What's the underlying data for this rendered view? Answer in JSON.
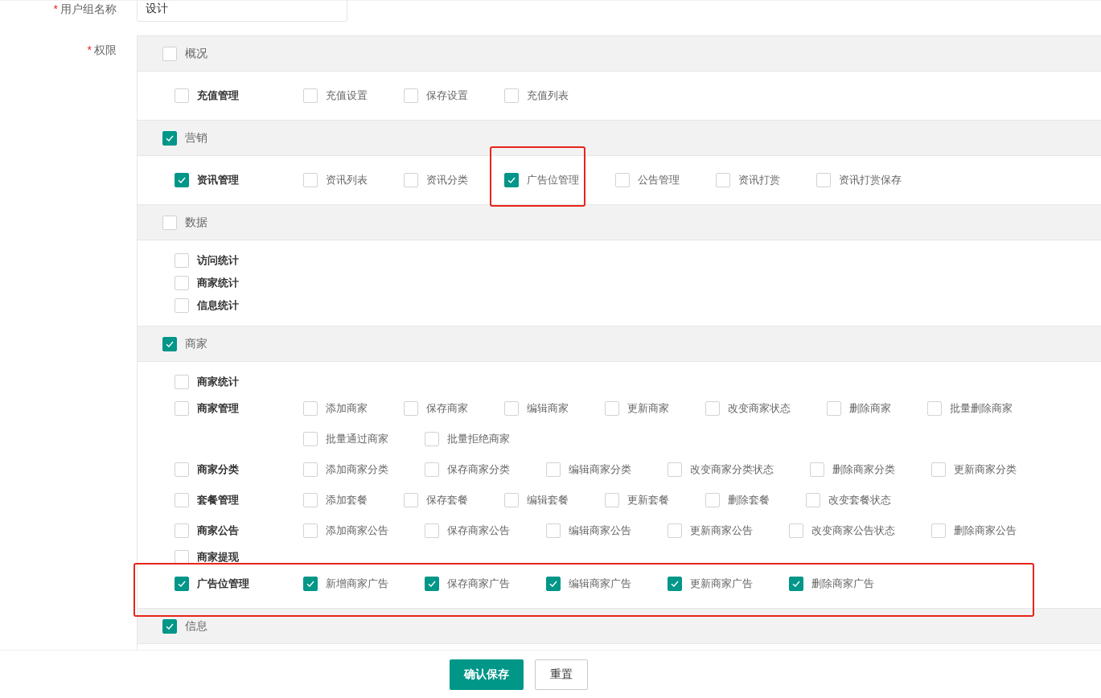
{
  "form": {
    "name_field": {
      "mark": "*",
      "label": "用户组名称",
      "value": "设计"
    },
    "permissions": {
      "mark": "*",
      "label": "权限"
    }
  },
  "sections": [
    {
      "label": "概况",
      "checked": false,
      "groups": [
        {
          "label": "充值管理",
          "checked": false,
          "highlighted": false,
          "children": [
            {
              "label": "充值设置",
              "checked": false,
              "highlighted": false
            },
            {
              "label": "保存设置",
              "checked": false,
              "highlighted": false
            },
            {
              "label": "充值列表",
              "checked": false,
              "highlighted": false
            }
          ]
        }
      ]
    },
    {
      "label": "营销",
      "checked": true,
      "groups": [
        {
          "label": "资讯管理",
          "checked": true,
          "highlighted": false,
          "children": [
            {
              "label": "资讯列表",
              "checked": false,
              "highlighted": false
            },
            {
              "label": "资讯分类",
              "checked": false,
              "highlighted": false
            },
            {
              "label": "广告位管理",
              "checked": true,
              "highlighted": true
            },
            {
              "label": "公告管理",
              "checked": false,
              "highlighted": false
            },
            {
              "label": "资讯打赏",
              "checked": false,
              "highlighted": false
            },
            {
              "label": "资讯打赏保存",
              "checked": false,
              "highlighted": false
            }
          ]
        }
      ]
    },
    {
      "label": "数据",
      "checked": false,
      "groups": [
        {
          "label": "访问统计",
          "checked": false,
          "highlighted": false
        },
        {
          "label": "商家统计",
          "checked": false,
          "highlighted": false
        },
        {
          "label": "信息统计",
          "checked": false,
          "highlighted": false
        }
      ]
    },
    {
      "label": "商家",
      "checked": true,
      "groups": [
        {
          "label": "商家统计",
          "checked": false,
          "highlighted": false
        },
        {
          "label": "商家管理",
          "checked": false,
          "highlighted": false,
          "children": [
            {
              "label": "添加商家",
              "checked": false,
              "highlighted": false
            },
            {
              "label": "保存商家",
              "checked": false,
              "highlighted": false
            },
            {
              "label": "编辑商家",
              "checked": false,
              "highlighted": false
            },
            {
              "label": "更新商家",
              "checked": false,
              "highlighted": false
            },
            {
              "label": "改变商家状态",
              "checked": false,
              "highlighted": false
            },
            {
              "label": "删除商家",
              "checked": false,
              "highlighted": false
            },
            {
              "label": "批量删除商家",
              "checked": false,
              "highlighted": false
            },
            {
              "label": "批量通过商家",
              "checked": false,
              "highlighted": false
            },
            {
              "label": "批量拒绝商家",
              "checked": false,
              "highlighted": false
            }
          ]
        },
        {
          "label": "商家分类",
          "checked": false,
          "highlighted": false,
          "children": [
            {
              "label": "添加商家分类",
              "checked": false,
              "highlighted": false
            },
            {
              "label": "保存商家分类",
              "checked": false,
              "highlighted": false
            },
            {
              "label": "编辑商家分类",
              "checked": false,
              "highlighted": false
            },
            {
              "label": "改变商家分类状态",
              "checked": false,
              "highlighted": false
            },
            {
              "label": "删除商家分类",
              "checked": false,
              "highlighted": false
            },
            {
              "label": "更新商家分类",
              "checked": false,
              "highlighted": false
            }
          ]
        },
        {
          "label": "套餐管理",
          "checked": false,
          "highlighted": false,
          "children": [
            {
              "label": "添加套餐",
              "checked": false,
              "highlighted": false
            },
            {
              "label": "保存套餐",
              "checked": false,
              "highlighted": false
            },
            {
              "label": "编辑套餐",
              "checked": false,
              "highlighted": false
            },
            {
              "label": "更新套餐",
              "checked": false,
              "highlighted": false
            },
            {
              "label": "删除套餐",
              "checked": false,
              "highlighted": false
            },
            {
              "label": "改变套餐状态",
              "checked": false,
              "highlighted": false
            }
          ]
        },
        {
          "label": "商家公告",
          "checked": false,
          "highlighted": false,
          "children": [
            {
              "label": "添加商家公告",
              "checked": false,
              "highlighted": false
            },
            {
              "label": "保存商家公告",
              "checked": false,
              "highlighted": false
            },
            {
              "label": "编辑商家公告",
              "checked": false,
              "highlighted": false
            },
            {
              "label": "更新商家公告",
              "checked": false,
              "highlighted": false
            },
            {
              "label": "改变商家公告状态",
              "checked": false,
              "highlighted": false
            },
            {
              "label": "删除商家公告",
              "checked": false,
              "highlighted": false
            }
          ]
        },
        {
          "label": "商家提现",
          "checked": false,
          "highlighted": false
        },
        {
          "label": "广告位管理",
          "checked": true,
          "highlighted": true,
          "children": [
            {
              "label": "新增商家广告",
              "checked": true,
              "highlighted": false
            },
            {
              "label": "保存商家广告",
              "checked": true,
              "highlighted": false
            },
            {
              "label": "编辑商家广告",
              "checked": true,
              "highlighted": false
            },
            {
              "label": "更新商家广告",
              "checked": true,
              "highlighted": false
            },
            {
              "label": "删除商家广告",
              "checked": true,
              "highlighted": false
            }
          ]
        }
      ]
    },
    {
      "label": "信息",
      "checked": true
    }
  ],
  "buttons": [
    {
      "label": "确认保存",
      "kind": "primary"
    },
    {
      "label": "重置",
      "kind": "default"
    }
  ]
}
